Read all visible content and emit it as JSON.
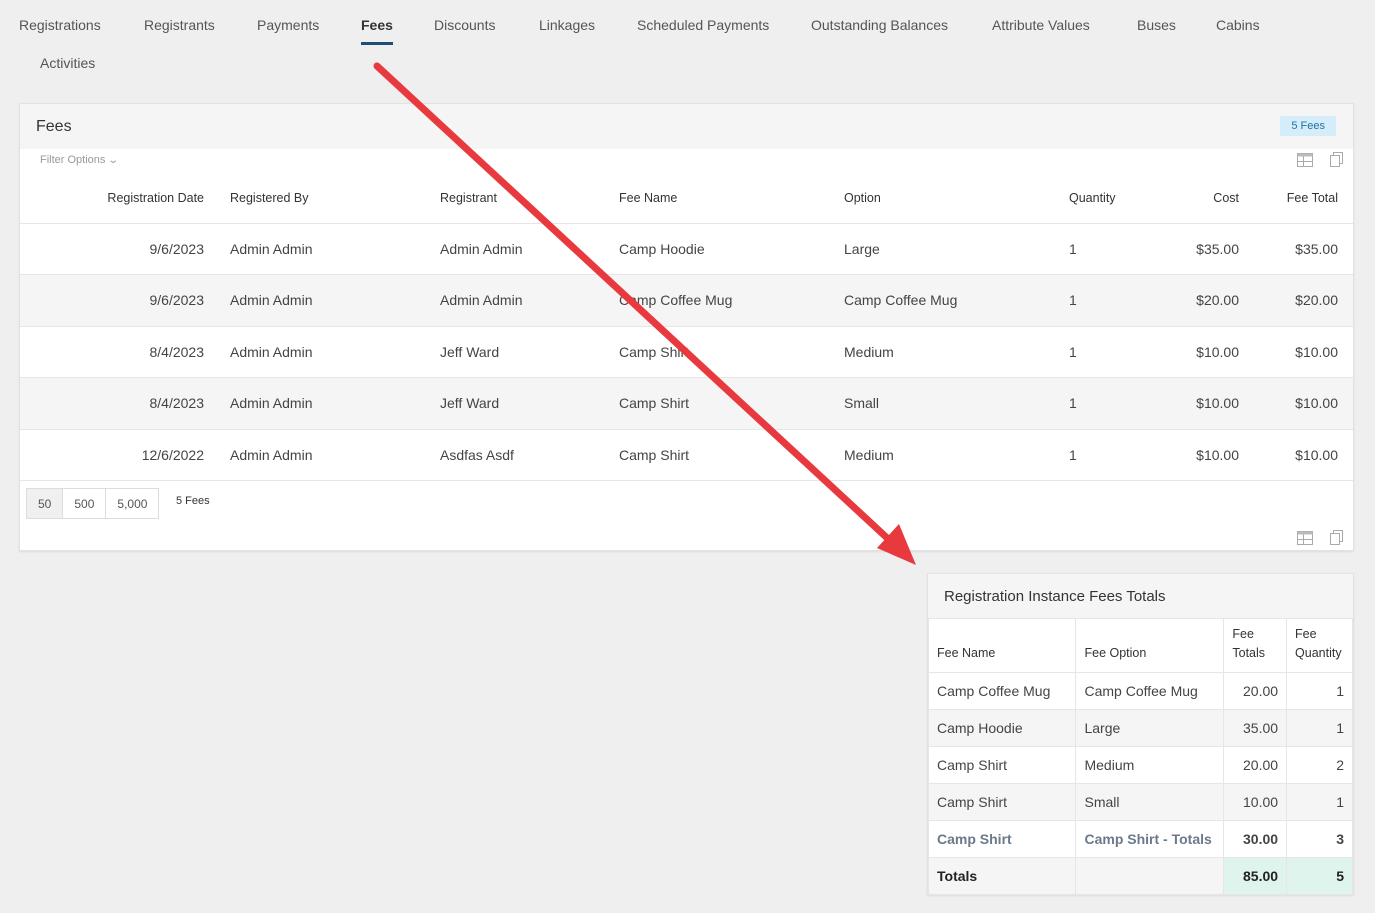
{
  "tabs": [
    {
      "label": "Registrations"
    },
    {
      "label": "Registrants"
    },
    {
      "label": "Payments"
    },
    {
      "label": "Fees",
      "active": true
    },
    {
      "label": "Discounts"
    },
    {
      "label": "Linkages"
    },
    {
      "label": "Scheduled Payments"
    },
    {
      "label": "Outstanding Balances"
    },
    {
      "label": "Attribute Values"
    },
    {
      "label": "Buses"
    },
    {
      "label": "Cabins"
    },
    {
      "label": "Activities"
    }
  ],
  "fees_panel": {
    "title": "Fees",
    "badge": "5 Fees",
    "filter_label": "Filter Options",
    "columns": [
      "Registration Date",
      "Registered By",
      "Registrant",
      "Fee Name",
      "Option",
      "Quantity",
      "Cost",
      "Fee Total"
    ],
    "rows": [
      [
        "9/6/2023",
        "Admin Admin",
        "Admin Admin",
        "Camp Hoodie",
        "Large",
        "1",
        "$35.00",
        "$35.00"
      ],
      [
        "9/6/2023",
        "Admin Admin",
        "Admin Admin",
        "Camp Coffee Mug",
        "Camp Coffee Mug",
        "1",
        "$20.00",
        "$20.00"
      ],
      [
        "8/4/2023",
        "Admin Admin",
        "Jeff Ward",
        "Camp Shirt",
        "Medium",
        "1",
        "$10.00",
        "$10.00"
      ],
      [
        "8/4/2023",
        "Admin Admin",
        "Jeff Ward",
        "Camp Shirt",
        "Small",
        "1",
        "$10.00",
        "$10.00"
      ],
      [
        "12/6/2022",
        "Admin Admin",
        "Asdfas Asdf",
        "Camp Shirt",
        "Medium",
        "1",
        "$10.00",
        "$10.00"
      ]
    ],
    "page_sizes": [
      "50",
      "500",
      "5,000"
    ],
    "count_label": "5 Fees"
  },
  "totals_panel": {
    "title": "Registration Instance Fees Totals",
    "columns": [
      "Fee Name",
      "Fee Option",
      "Fee Totals",
      "Fee Quantity"
    ],
    "rows": [
      [
        "Camp Coffee Mug",
        "Camp Coffee Mug",
        "20.00",
        "1"
      ],
      [
        "Camp Hoodie",
        "Large",
        "35.00",
        "1"
      ],
      [
        "Camp Shirt",
        "Medium",
        "20.00",
        "2"
      ],
      [
        "Camp Shirt",
        "Small",
        "10.00",
        "1"
      ]
    ],
    "subtotal": [
      "Camp Shirt",
      "Camp Shirt - Totals",
      "30.00",
      "3"
    ],
    "grand_total": {
      "label": "Totals",
      "amount": "85.00",
      "quantity": "5"
    }
  },
  "colors": {
    "tab_underline": "#1f4e79",
    "badge_bg": "#d5ecfb",
    "badge_text": "#2472a4",
    "total_highlight": "#def4ec",
    "arrow": "#e8393f"
  },
  "icons": [
    "grid-icon",
    "copy-icon",
    "chevron-down-icon",
    "annotation-arrow"
  ]
}
